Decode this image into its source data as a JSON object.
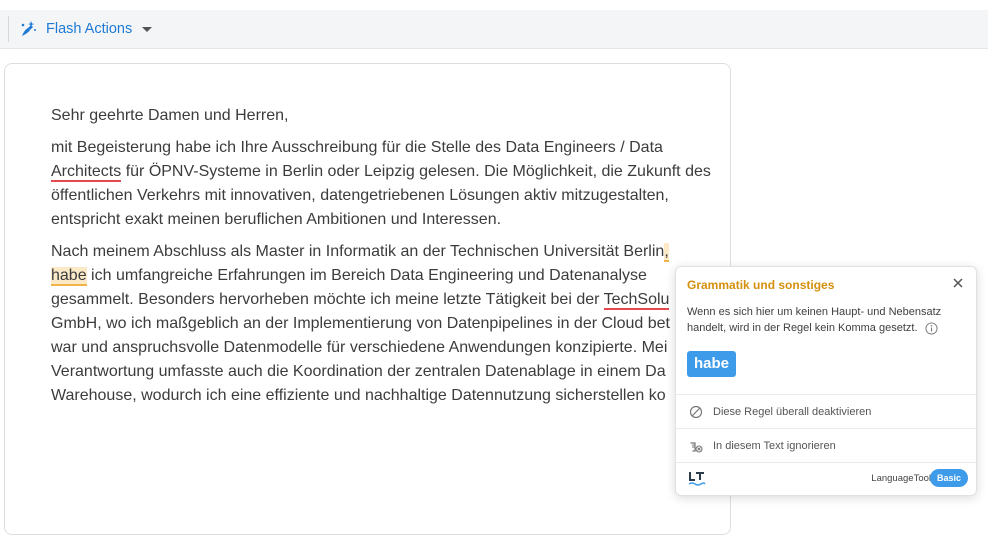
{
  "toolbar": {
    "flash_label": "Flash Actions",
    "flash_icon": "sparkle-hand-icon",
    "accent_color": "#1f7ad6"
  },
  "document": {
    "greeting": "Sehr geehrte Damen und Herren,",
    "p1": {
      "l1": "mit Begeisterung habe ich Ihre Ausschreibung für die Stelle des Data Engineers / Data",
      "l2_err": "Architects",
      "l2_rest": " für ÖPNV-Systeme in Berlin oder Leipzig gelesen. Die Möglichkeit, die Zukunft des",
      "l3": "öffentlichen Verkehrs mit innovativen, datengetriebenen Lösungen aktiv mitzugestalten,",
      "l4": "entspricht exakt meinen beruflichen Ambitionen und Interessen."
    },
    "p2": {
      "l1_text": "Nach meinem Abschluss als Master in Informatik an der Technischen Universität Berlin",
      "l1_err": ",",
      "l2_err": "habe",
      "l2_rest": " ich umfangreiche Erfahrungen im Bereich Data Engineering und Datenanalyse",
      "l3_text": "gesammelt. Besonders hervorheben möchte ich meine letzte Tätigkeit bei der ",
      "l3_err": "TechSolu",
      "l4": "GmbH, wo ich maßgeblich an der Implementierung von Datenpipelines in der Cloud bet",
      "l5": "war und anspruchsvolle Datenmodelle für verschiedene Anwendungen konzipierte. Mei",
      "l6": "Verantwortung umfasste auch die Koordination der zentralen Datenablage in einem Da",
      "l7": "Warehouse, wodurch ich eine effiziente und nachhaltige Datennutzung sicherstellen ko"
    },
    "colors": {
      "spelling_underline": "#e5484d",
      "grammar_underline": "#f0b548"
    }
  },
  "popup": {
    "title": "Grammatik und sonstiges",
    "message": "Wenn es sich hier um keinen Haupt- und Nebensatz handelt, wird in der Regel kein Komma gesetzt.",
    "suggestion": "habe",
    "action_disable": "Diese Regel überall deaktivieren",
    "action_ignore": "In diesem Text ignorieren",
    "brand": "LanguageTool",
    "plan": "Basic",
    "title_color": "#d4900c",
    "accent_color": "#3d9be9"
  }
}
